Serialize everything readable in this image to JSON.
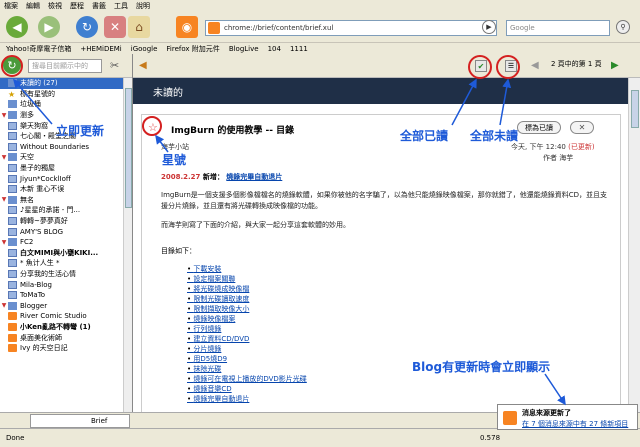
{
  "browser": {
    "menu": [
      "檔案",
      "編輯",
      "檢視",
      "歷程",
      "書籤",
      "工具",
      "說明"
    ],
    "url": "chrome://brief/content/brief.xul",
    "search_placeholder": "Google",
    "bookmarks": [
      "Yahoo!奇摩電子信箱",
      "+HEMiDEMi",
      "iGoogle",
      "Firefox 附加元件",
      "BlogLive",
      "104",
      "1111"
    ]
  },
  "sidebar": {
    "search_placeholder": "搜尋目前顯示中的",
    "items": [
      {
        "label": "未讀的 (27)",
        "kind": "folder",
        "selected": true
      },
      {
        "label": "標有星號的",
        "kind": "star"
      },
      {
        "label": "垃圾桶",
        "kind": "folder"
      },
      {
        "label": "瀏多",
        "kind": "group"
      },
      {
        "label": "樂天狗窩",
        "kind": "feed"
      },
      {
        "label": "七心閣・殿堂之閣",
        "kind": "feed"
      },
      {
        "label": "Without Boundaries",
        "kind": "feed"
      },
      {
        "label": "天空",
        "kind": "group"
      },
      {
        "label": "墨子的獨屋",
        "kind": "feed"
      },
      {
        "label": "Jiyun*CocklIoff",
        "kind": "feed"
      },
      {
        "label": "木新 重心不误",
        "kind": "feed"
      },
      {
        "label": "無名",
        "kind": "group"
      },
      {
        "label": "♪星星的承諾 - 門...",
        "kind": "feed"
      },
      {
        "label": "轉轉~夢夢真好",
        "kind": "feed"
      },
      {
        "label": "AMY'S BLOG",
        "kind": "feed"
      },
      {
        "label": "FC2",
        "kind": "group"
      },
      {
        "label": "白文MIMI與小甕KIKI...",
        "kind": "feed",
        "bold": true
      },
      {
        "label": "* 魚计人生 *",
        "kind": "feed"
      },
      {
        "label": "分享我的生活心情",
        "kind": "feed"
      },
      {
        "label": "Mila-Blog",
        "kind": "feed"
      },
      {
        "label": "ToMaTo",
        "kind": "feed"
      },
      {
        "label": "Blogger",
        "kind": "group"
      },
      {
        "label": "River Comic Studio",
        "kind": "rss"
      },
      {
        "label": "小Ken亂路不轉彎 (1)",
        "kind": "rss",
        "bold": true
      },
      {
        "label": "桌面美化術師",
        "kind": "rss"
      },
      {
        "label": "Ivy 的天空日記",
        "kind": "rss"
      }
    ]
  },
  "main": {
    "header_title": "未讀的",
    "page_info": "2 頁中的第 1 頁",
    "article": {
      "title": "ImgBurn 的使用教學 -- 目錄",
      "unread_button": "標為已讀",
      "close_button": "✕",
      "source": "海芋小站",
      "date": "今天, 下午 12:40",
      "updated": "(已更新)",
      "author": "作者 海芋",
      "new_date": "2008.2.27",
      "new_label": "新增：",
      "new_link": "燒錄完畢自動退片",
      "paragraph1": "ImgBurn是一個支援多個影像檔檔名的燒錄軟體，如果你被他的名字騙了，以為他只能燒錄映像檔案，那你就錯了，他還能燒錄資料CD，並且支援分片燒錄，並且還有將光碟轉換成映像檔的功能。",
      "paragraph2": "而海芋則寫了下面的介紹，與大家一起分享這套軟體的妙用。",
      "toc_label": "目錄如下：",
      "toc": [
        "下載安裝",
        "設定檔案關聯",
        "將光碟燒成映像檔",
        "限制光碟讀取速度",
        "限制擷取映像大小",
        "燒錄映像檔案",
        "行列燒錄",
        "建立資料CD/DVD",
        "分片燒錄",
        "用D5燒D9",
        "抹除光碟",
        "燒錄可在電視上播放的DVD影片光碟",
        "燒錄音樂CD",
        "燒錄完畢自動退片"
      ]
    }
  },
  "tab": {
    "label": "Brief"
  },
  "status": {
    "text": "Done",
    "zoom": "0.578"
  },
  "notification": {
    "title": "消息來源更新了",
    "message": "在 7 個消息來源中有 27 條新項目"
  },
  "annotations": {
    "refresh": "立即更新",
    "mark_all_read": "全部已讀",
    "mark_all_unread": "全部未讀",
    "star": "星號",
    "blog_update": "Blog有更新時會立即顯示"
  },
  "colors": {
    "accent": "#1e5ad8",
    "highlight": "#d42020",
    "banner": "#1f2f47",
    "rss": "#f78422"
  }
}
